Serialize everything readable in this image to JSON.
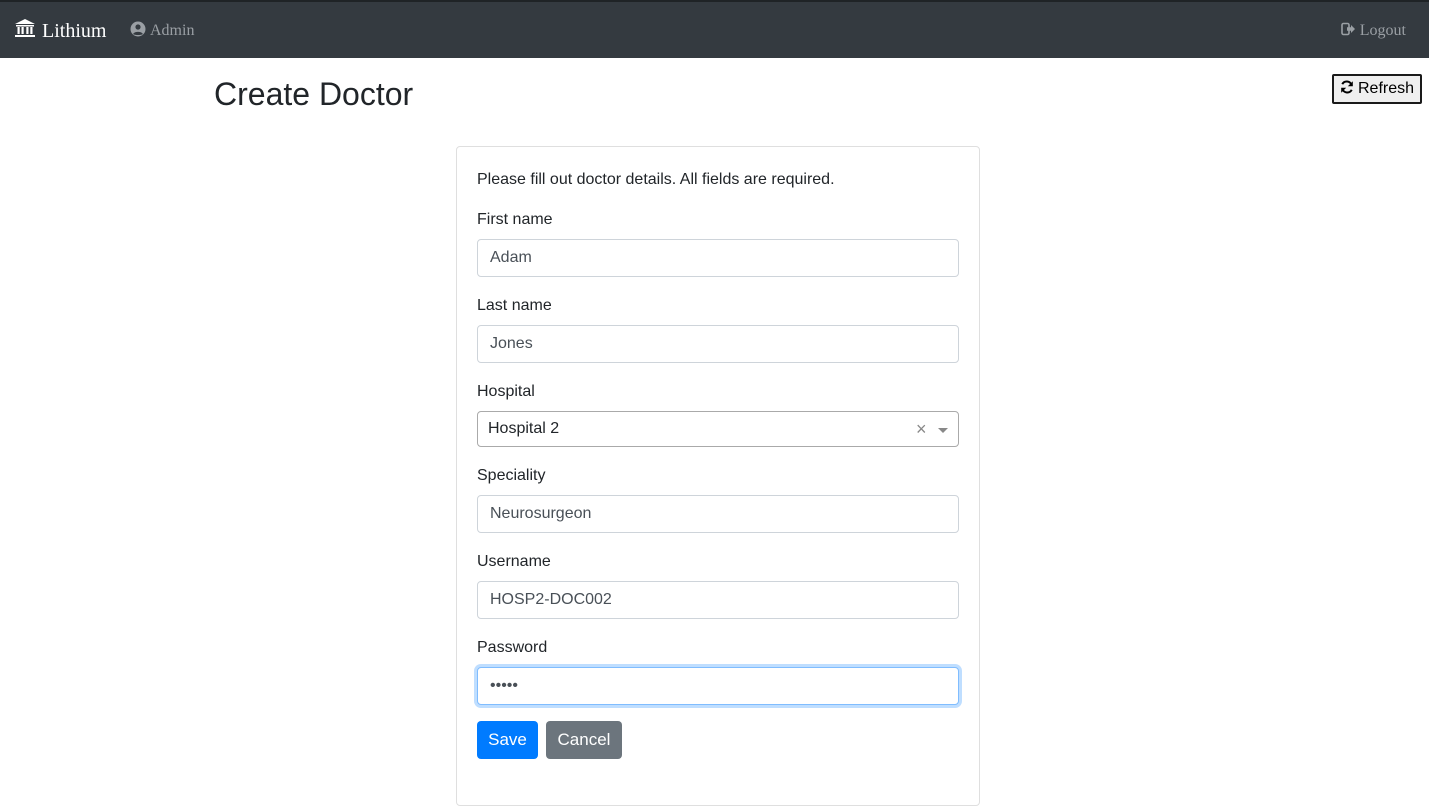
{
  "navbar": {
    "brand": "Lithium",
    "brand_icon": "bank-icon",
    "user_label": "Admin",
    "user_icon": "user-circle-icon",
    "logout_label": "Logout",
    "logout_icon": "sign-out-icon",
    "background": "#343a40"
  },
  "page": {
    "title": "Create Doctor",
    "refresh_label": "Refresh",
    "refresh_icon": "refresh-icon"
  },
  "form": {
    "intro": "Please fill out doctor details. All fields are required.",
    "first_name": {
      "label": "First name",
      "value": "Adam"
    },
    "last_name": {
      "label": "Last name",
      "value": "Jones"
    },
    "hospital": {
      "label": "Hospital",
      "value": "Hospital 2"
    },
    "speciality": {
      "label": "Speciality",
      "value": "Neurosurgeon"
    },
    "username": {
      "label": "Username",
      "value": "HOSP2-DOC002"
    },
    "password": {
      "label": "Password",
      "value": "•••••"
    },
    "save_label": "Save",
    "cancel_label": "Cancel"
  },
  "colors": {
    "primary": "#007bff",
    "secondary": "#6c757d",
    "focus": "#80bdff"
  }
}
